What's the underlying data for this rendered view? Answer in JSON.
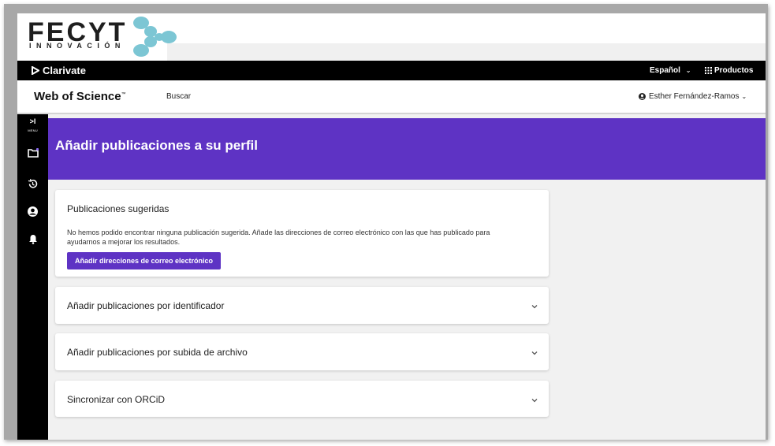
{
  "logo": {
    "wordmark": "FECYT",
    "tagline": "INNOVACIÓN"
  },
  "topbar": {
    "brand": "Clarivate",
    "language": "Español",
    "products": "Productos"
  },
  "header": {
    "title": "Web of Science",
    "trademark": "™",
    "search_link": "Buscar",
    "user_name": "Esther Fernández-Ramos"
  },
  "sidebar": {
    "toggle_icon": ">I",
    "menu_label": "MENU",
    "items": [
      {
        "icon": "folder-icon"
      },
      {
        "icon": "history-icon"
      },
      {
        "icon": "account-circle-icon"
      },
      {
        "icon": "bell-icon"
      }
    ]
  },
  "banner": {
    "title": "Añadir publicaciones a su perfil"
  },
  "cards": {
    "suggested": {
      "title": "Publicaciones sugeridas",
      "description": "No hemos podido encontrar ninguna publicación sugerida. Añade las direcciones de correo electrónico con las que has publicado para ayudarnos a mejorar los resultados.",
      "button": "Añadir direcciones de correo electrónico"
    },
    "by_identifier": {
      "title": "Añadir publicaciones por identificador"
    },
    "by_upload": {
      "title": "Añadir publicaciones por subida de archivo"
    },
    "orcid": {
      "title": "Sincronizar con ORCiD"
    }
  },
  "colors": {
    "accent_purple": "#5e33c4",
    "logo_teal": "#7cc6d4",
    "topbar_black": "#000000"
  }
}
